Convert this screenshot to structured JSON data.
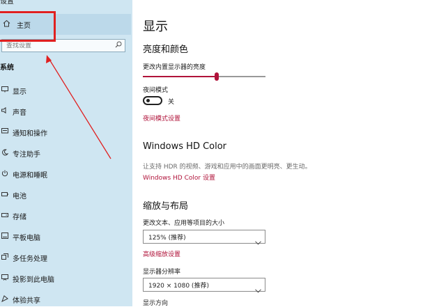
{
  "app_title": "设置",
  "sidebar": {
    "home_label": "主页",
    "search_placeholder": "查找设置",
    "section_label": "系统",
    "items": [
      {
        "label": "显示",
        "icon": "monitor-icon"
      },
      {
        "label": "声音",
        "icon": "speaker-icon"
      },
      {
        "label": "通知和操作",
        "icon": "notification-icon"
      },
      {
        "label": "专注助手",
        "icon": "moon-icon"
      },
      {
        "label": "电源和睡眠",
        "icon": "power-icon"
      },
      {
        "label": "电池",
        "icon": "battery-icon"
      },
      {
        "label": "存储",
        "icon": "storage-icon"
      },
      {
        "label": "平板电脑",
        "icon": "tablet-icon"
      },
      {
        "label": "多任务处理",
        "icon": "multitask-icon"
      },
      {
        "label": "投影到此电脑",
        "icon": "project-icon"
      },
      {
        "label": "体验共享",
        "icon": "share-icon"
      }
    ]
  },
  "main": {
    "title": "显示",
    "brightness": {
      "heading": "亮度和颜色",
      "slider_label": "更改内置显示器的亮度",
      "value": 0.6
    },
    "night_light": {
      "label": "夜间模式",
      "state": "关",
      "settings_link": "夜间模式设置"
    },
    "hd_color": {
      "heading": "Windows HD Color",
      "description": "让支持 HDR 的视频、游戏和应用中的画面更明亮、更生动。",
      "link": "Windows HD Color 设置"
    },
    "scale_layout": {
      "heading": "缩放与布局",
      "scale_label": "更改文本、应用等项目的大小",
      "scale_value": "125% (推荐)",
      "advanced_link": "高级缩放设置",
      "resolution_label": "显示器分辨率",
      "resolution_value": "1920 × 1080 (推荐)",
      "orientation_label": "显示方向"
    }
  },
  "colors": {
    "accent": "#b0133a",
    "sidebar_bg": "#cfe6f2",
    "annotation_red": "#e02020"
  }
}
